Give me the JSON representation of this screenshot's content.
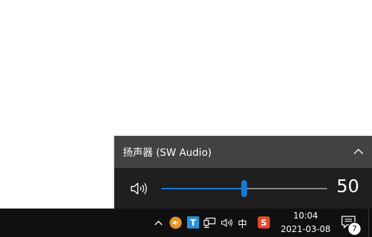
{
  "volume_flyout": {
    "device_name": "扬声器 (SW Audio)",
    "volume_value": "50",
    "volume_level": 50,
    "icons": {
      "collapse": "chevron-up-icon",
      "speaker": "speaker-icon"
    }
  },
  "taskbar": {
    "tray": {
      "ime_mode": "中",
      "t_app_letter": "T",
      "sogou_letter": "S",
      "icons": [
        "show-hidden-icons-chevron",
        "speaker-app-icon",
        "t-app-icon",
        "network-icon",
        "volume-icon",
        "ime-mode",
        "sogou-ime-icon"
      ]
    },
    "clock": {
      "time": "10:04",
      "date": "2021-03-08"
    },
    "action_center": {
      "badge_count": "7"
    }
  },
  "colors": {
    "flyout_background": "#1f1f1f",
    "flyout_header": "#424242",
    "accent": "#1a78d2",
    "taskbar": "#101010",
    "speaker_app": "#e8912c",
    "t_app": "#2b8fd6",
    "sogou": "#e8462c"
  }
}
